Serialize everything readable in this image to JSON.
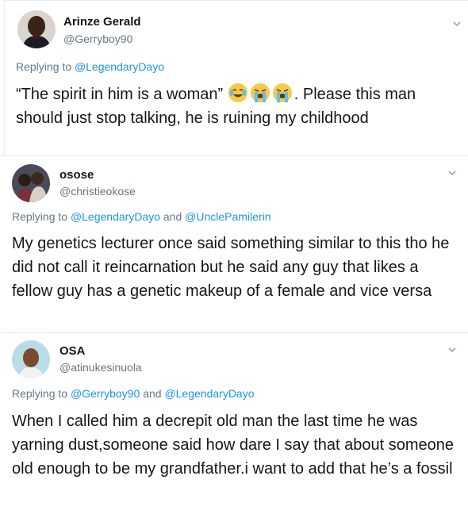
{
  "tweets": [
    {
      "name": "Arinze Gerald",
      "handle": "@Gerryboy90",
      "reply_prefix": "Replying to",
      "mentions": [
        "@LegendaryDayo"
      ],
      "text_before": "“The spirit in him is a woman” ",
      "emojis": [
        "face-with-tears-of-joy",
        "loudly-crying-face",
        "loudly-crying-face"
      ],
      "text_after": ". Please this man should just stop talking, he is ruining my childhood"
    },
    {
      "name": "osose",
      "handle": "@christieokose",
      "reply_prefix": "Replying to",
      "mentions": [
        "@LegendaryDayo",
        "@UnclePamilerin"
      ],
      "mention_joiner": "and",
      "text": "My genetics lecturer once said something similar to this tho he did not call it reincarnation but he said any guy that likes a fellow guy has a genetic makeup of a female and vice versa"
    },
    {
      "name": "OSA",
      "handle": "@atinukesinuola",
      "reply_prefix": "Replying to",
      "mentions": [
        "@Gerryboy90",
        "@LegendaryDayo"
      ],
      "mention_joiner": "and",
      "text": "When I called him a decrepit old man the last time he was yarning dust,someone said how dare I say that about someone old enough to be my grandfather.i want to add that he’s a fossil"
    }
  ],
  "icons": {
    "more": "chevron-down-icon"
  },
  "colors": {
    "link": "#1b95e0",
    "secondary_text": "#657786",
    "primary_text": "#14171a",
    "divider": "#e6ecf0"
  }
}
